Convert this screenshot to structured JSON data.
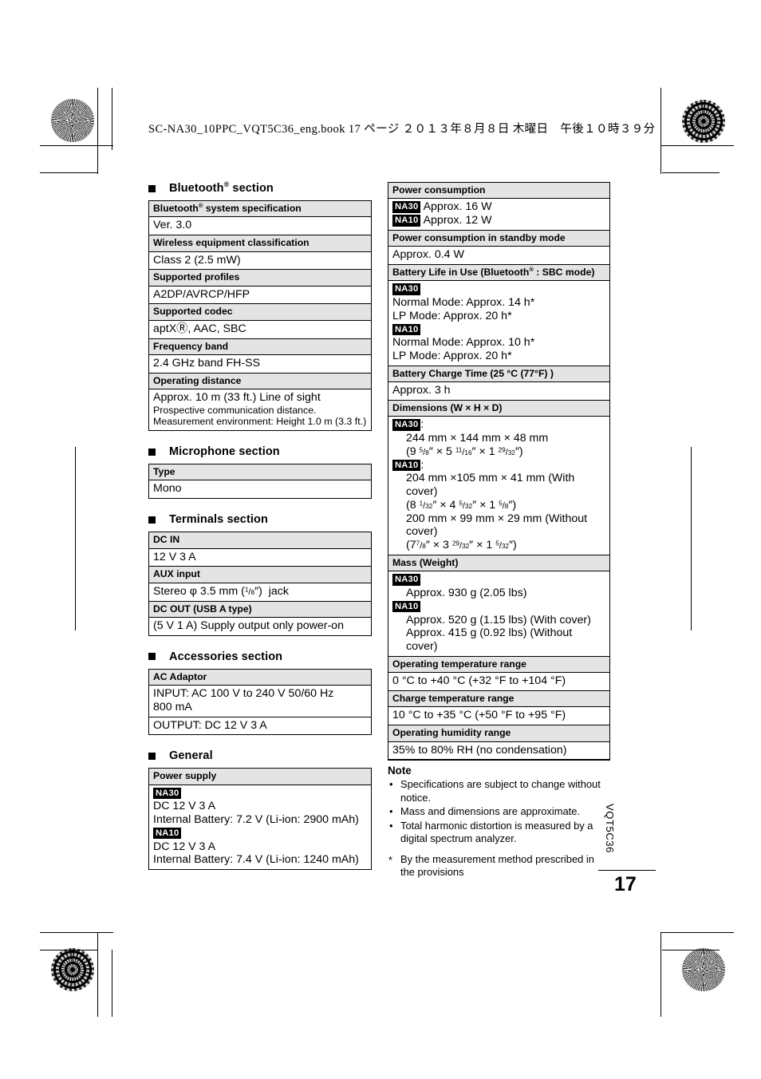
{
  "page": {
    "slug": "SC-NA30_10PPC_VQT5C36_eng.book  17 ページ  ２０１３年８月８日  木曜日　午後１０時３９分",
    "number": "17",
    "side_id": "VQT5C36"
  },
  "badges": {
    "na30": "NA30",
    "na10": "NA10"
  },
  "left_column": {
    "sections": [
      {
        "heading": "Bluetooth® section",
        "heading_base": "Bluetooth",
        "heading_sup": "®",
        "heading_rest": " section",
        "rows": [
          {
            "header": "Bluetooth® system specification",
            "value": "Ver. 3.0"
          },
          {
            "header": "Wireless equipment classification",
            "value": "Class 2 (2.5 mW)"
          },
          {
            "header": "Supported profiles",
            "value": "A2DP/AVRCP/HFP"
          },
          {
            "header": "Supported codec",
            "value": "aptXⓇ, AAC, SBC"
          },
          {
            "header": "Frequency band",
            "value": "2.4 GHz band FH-SS"
          },
          {
            "header": "Operating distance",
            "value_lines": [
              "Approx. 10 m (33 ft.) Line of sight",
              "Prospective communication distance.",
              "Measurement environment: Height 1.0 m (3.3 ft.)"
            ]
          }
        ]
      },
      {
        "heading": "Microphone section",
        "rows": [
          {
            "header": "Type",
            "value": "Mono"
          }
        ]
      },
      {
        "heading": "Terminals section",
        "rows": [
          {
            "header": "DC IN",
            "value": "12 V 3 A"
          },
          {
            "header": "AUX input",
            "value": "Stereo φ 3.5 mm (1/8″)  jack"
          },
          {
            "header": "DC OUT (USB A type)",
            "value": "(5 V 1 A) Supply output only power-on"
          }
        ]
      },
      {
        "heading": "Accessories section",
        "rows": [
          {
            "header": "AC Adaptor",
            "value_lines": [
              "INPUT: AC 100 V to 240 V 50/60 Hz",
              "800 mA"
            ],
            "second_value": "OUTPUT: DC 12 V 3 A"
          }
        ]
      },
      {
        "heading": "General",
        "rows": [
          {
            "header": "Power supply",
            "na30_lines": [
              "DC 12 V 3 A",
              "Internal Battery: 7.2 V (Li-ion: 2900 mAh)"
            ],
            "na10_lines": [
              "DC 12 V 3 A",
              "Internal Battery: 7.4 V (Li-ion: 1240 mAh)"
            ]
          }
        ]
      }
    ]
  },
  "right_column": {
    "rows": [
      {
        "header": "Power consumption",
        "na30_inline": "Approx. 16  W",
        "na10_inline": "Approx. 12  W"
      },
      {
        "header": "Power consumption in standby mode",
        "value": "Approx. 0.4  W"
      },
      {
        "header": "Battery Life in Use (Bluetooth® : SBC mode)",
        "na30_lines": [
          "Normal Mode: Approx. 14 h*",
          "LP Mode: Approx. 20 h*"
        ],
        "na10_lines": [
          "Normal Mode: Approx. 10 h*",
          "LP Mode: Approx. 20 h*"
        ]
      },
      {
        "header": "Battery Charge Time (25 °C (77°F) )",
        "value": "Approx. 3 h"
      },
      {
        "header": "Dimensions (W × H × D)",
        "na30_lines": [
          "244 mm × 144 mm × 48 mm",
          "(9 5/8″ × 5 11/16″ × 1 29/32″)"
        ],
        "na10_lines": [
          "204 mm ×105 mm × 41 mm (With cover)",
          "(8 1/32″ × 4 5/32″ × 1 5/8″)",
          "200 mm × 99 mm × 29 mm (Without cover)",
          "(7 7/8″ × 3 29/32″ × 1 5/32″)"
        ]
      },
      {
        "header": "Mass (Weight)",
        "na30_lines": [
          "Approx. 930 g (2.05 lbs)"
        ],
        "na10_lines": [
          "Approx. 520 g (1.15 lbs) (With cover)",
          "Approx. 415 g (0.92 lbs) (Without",
          "cover)"
        ]
      },
      {
        "header": "Operating temperature range",
        "value": "0 °C to +40 °C (+32 °F to +104 °F)"
      },
      {
        "header": "Charge temperature range",
        "value": "10 °C to +35 °C (+50 °F to +95 °F)"
      },
      {
        "header": "Operating humidity range",
        "value": "35% to 80% RH (no condensation)"
      }
    ]
  },
  "note": {
    "title": "Note",
    "items": [
      "Specifications are subject to change without notice.",
      "Mass and dimensions are approximate.",
      "Total harmonic distortion is measured by a digital spectrum analyzer."
    ],
    "footnote_marker": "*",
    "footnote": "By the measurement method prescribed in the provisions"
  }
}
